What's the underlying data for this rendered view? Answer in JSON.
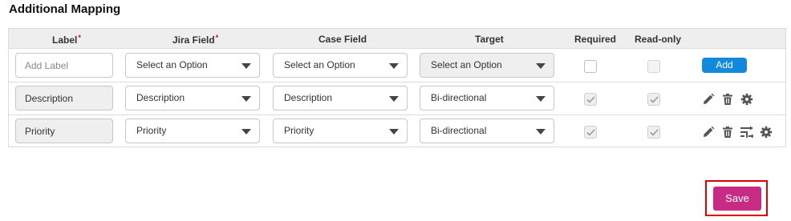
{
  "section": {
    "title": "Additional Mapping"
  },
  "table": {
    "headers": {
      "label": "Label",
      "jira_field": "Jira Field",
      "case_field": "Case Field",
      "target": "Target",
      "required": "Required",
      "read_only": "Read-only"
    },
    "required_marker": "*",
    "new_row": {
      "label_placeholder": "Add Label",
      "jira_field": "Select an Option",
      "case_field": "Select an Option",
      "target": "Select an Option",
      "required_checked": false,
      "read_only_checked": false,
      "add_label": "Add"
    },
    "rows": [
      {
        "label": "Description",
        "jira_field": "Description",
        "case_field": "Description",
        "target": "Bi-directional",
        "required_checked": true,
        "read_only_checked": true,
        "actions": [
          "pencil-icon",
          "trash-icon",
          "gear-icon"
        ]
      },
      {
        "label": "Priority",
        "jira_field": "Priority",
        "case_field": "Priority",
        "target": "Bi-directional",
        "required_checked": true,
        "read_only_checked": true,
        "actions": [
          "pencil-icon",
          "trash-icon",
          "value-mapping-icon",
          "gear-icon"
        ]
      }
    ]
  },
  "footer": {
    "save_label": "Save"
  },
  "colors": {
    "add_button": "#1389de",
    "save_button": "#c72b84",
    "highlight_outline": "#e00000",
    "required_star": "#d0021b"
  }
}
